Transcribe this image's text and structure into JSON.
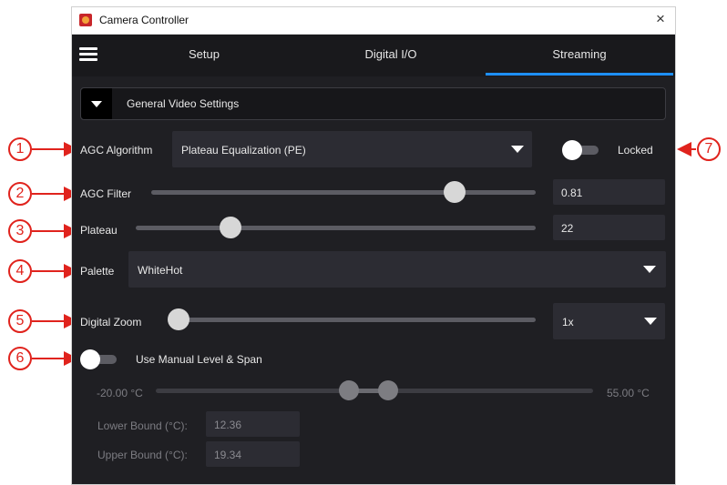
{
  "window": {
    "title": "Camera Controller",
    "close_glyph": "×"
  },
  "tabs": [
    {
      "label": "Setup"
    },
    {
      "label": "Digital I/O"
    },
    {
      "label": "Streaming",
      "active": true
    }
  ],
  "general": {
    "label": "General Video Settings"
  },
  "agc_algorithm": {
    "label": "AGC Algorithm",
    "value": "Plateau Equalization (PE)"
  },
  "locked": {
    "label": "Locked",
    "on": true
  },
  "agc_filter": {
    "label": "AGC Filter",
    "value": "0.81",
    "slider_fraction": 0.8
  },
  "plateau": {
    "label": "Plateau",
    "value": "22",
    "slider_fraction": 0.2
  },
  "palette": {
    "label": "Palette",
    "value": "WhiteHot"
  },
  "digital_zoom": {
    "label": "Digital Zoom",
    "value": "1x",
    "slider_fraction": 0.0
  },
  "manual_level": {
    "label": "Use Manual Level & Span",
    "on": false,
    "min_label": "-20.00 °C",
    "max_label": "55.00 °C",
    "lower_label": "Lower Bound (°C):",
    "lower_value": "12.36",
    "upper_label": "Upper Bound (°C):",
    "upper_value": "19.34"
  },
  "callouts": [
    "1",
    "2",
    "3",
    "4",
    "5",
    "6",
    "7"
  ],
  "colors": {
    "accent": "#1e8fff",
    "callout": "#e0231d",
    "panel": "#1f1f23",
    "control": "#2c2c33"
  }
}
